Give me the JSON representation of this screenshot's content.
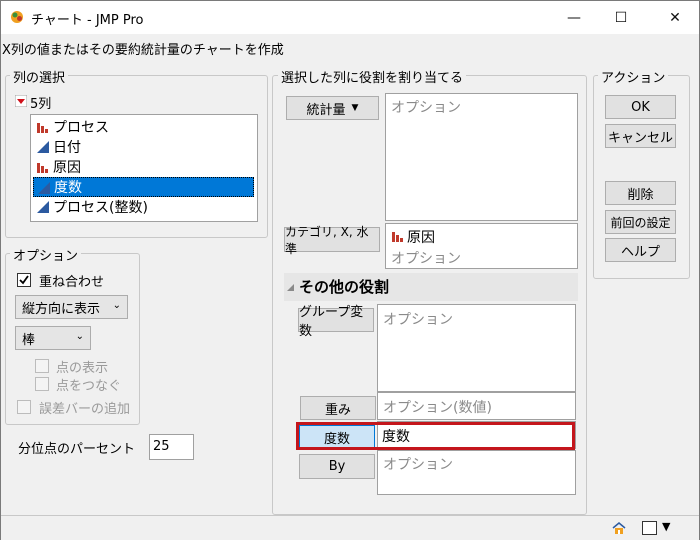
{
  "window": {
    "title": "チャート - JMP Pro",
    "subtitle": "X列の値またはその要約統計量のチャートを作成",
    "minimize": "—",
    "maximize": "☐",
    "close": "✕"
  },
  "column_select": {
    "group_label": "列の選択",
    "count_label": "5列",
    "items": [
      {
        "label": "プロセス",
        "icon": "nominal-bar-icon",
        "selected": false
      },
      {
        "label": "日付",
        "icon": "continuous-triangle-icon",
        "selected": false
      },
      {
        "label": "原因",
        "icon": "nominal-bar-icon",
        "selected": false
      },
      {
        "label": "度数",
        "icon": "continuous-triangle-icon",
        "selected": true
      },
      {
        "label": "プロセス(整数)",
        "icon": "continuous-triangle-icon",
        "selected": false
      }
    ]
  },
  "roles": {
    "group_label": "選択した列に役割を割り当てる",
    "stats_button": "統計量",
    "stats_placeholder": "オプション",
    "category_button": "カテゴリ, X, 水準",
    "category_value": "原因",
    "category_placeholder": "オプション",
    "other_roles_label": "その他の役割",
    "group_var_button": "グループ変数",
    "group_var_placeholder": "オプション",
    "weight_button": "重み",
    "weight_placeholder": "オプション(数値)",
    "freq_button": "度数",
    "freq_value": "度数",
    "by_button": "By",
    "by_placeholder": "オプション"
  },
  "actions": {
    "group_label": "アクション",
    "ok": "OK",
    "cancel": "キャンセル",
    "remove": "削除",
    "recall": "前回の設定",
    "help": "ヘルプ"
  },
  "options": {
    "group_label": "オプション",
    "overlay_label": "重ね合わせ",
    "overlay_checked": true,
    "orientation": "縦方向に表示",
    "chart_type": "棒",
    "show_points": "点の表示",
    "connect_points": "点をつなぐ",
    "error_bars": "誤差バーの追加",
    "quantile_label": "分位点のパーセント",
    "quantile_value": "25"
  },
  "colors": {
    "selection": "#0078d7",
    "highlight_border": "#c4161c",
    "nominal_icon": "#c0392b",
    "continuous_icon": "#2c5aa0"
  }
}
